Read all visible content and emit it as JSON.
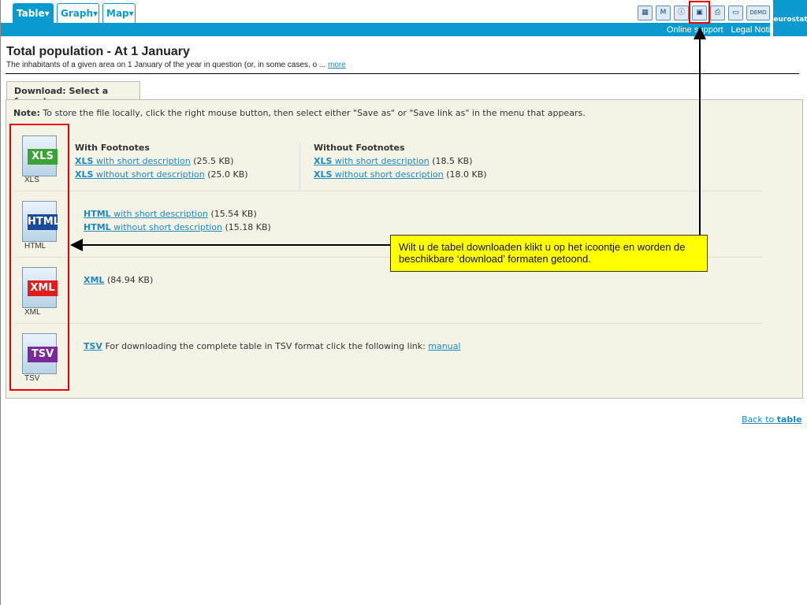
{
  "tabs": [
    "Table▾",
    "Graph▾",
    "Map▾"
  ],
  "toolbar": {
    "icons": [
      "table-icon",
      "metadata-icon",
      "info-icon",
      "save-icon",
      "print-icon",
      "folder-icon"
    ],
    "demo": "DEMO",
    "links": [
      "Online support",
      "Legal Notice"
    ],
    "logo": "eurostat"
  },
  "title": "Total population - At 1 January",
  "subtitle": "The inhabitants of a given area on 1 January of the year in question (or, in some cases, o ...",
  "more": "more",
  "format_tab": "Download: Select a format",
  "note_label": "Note:",
  "note": "To store the file locally, click the right mouse button, then select either \"Save as\" or \"Save link as\" in the menu that appears.",
  "xls": {
    "label": "XLS",
    "with_title": "With Footnotes",
    "without_title": "Without Footnotes",
    "with": [
      {
        "fmt": "XLS",
        "text": "with short description",
        "size": "(25.5 KB)"
      },
      {
        "fmt": "XLS",
        "text": "without short description",
        "size": "(25.0 KB)"
      }
    ],
    "without": [
      {
        "fmt": "XLS",
        "text": "with short description",
        "size": "(18.5 KB)"
      },
      {
        "fmt": "XLS",
        "text": "without short description",
        "size": "(18.0 KB)"
      }
    ]
  },
  "html": {
    "label": "HTML",
    "links": [
      {
        "fmt": "HTML",
        "text": "with short description",
        "size": "(15.54 KB)"
      },
      {
        "fmt": "HTML",
        "text": "without short description",
        "size": "(15.18 KB)"
      }
    ]
  },
  "xml": {
    "label": "XML",
    "fmt": "XML",
    "size": "(84.94 KB)"
  },
  "tsv": {
    "label": "TSV",
    "fmt": "TSV",
    "text": "For downloading the complete table in TSV format click the following link:",
    "link": "manual"
  },
  "callout": "Wilt u de tabel downloaden klikt u op het icoontje en worden de beschikbare ‘download’ formaten getoond.",
  "back": {
    "text": "Back to",
    "bold": "table"
  }
}
